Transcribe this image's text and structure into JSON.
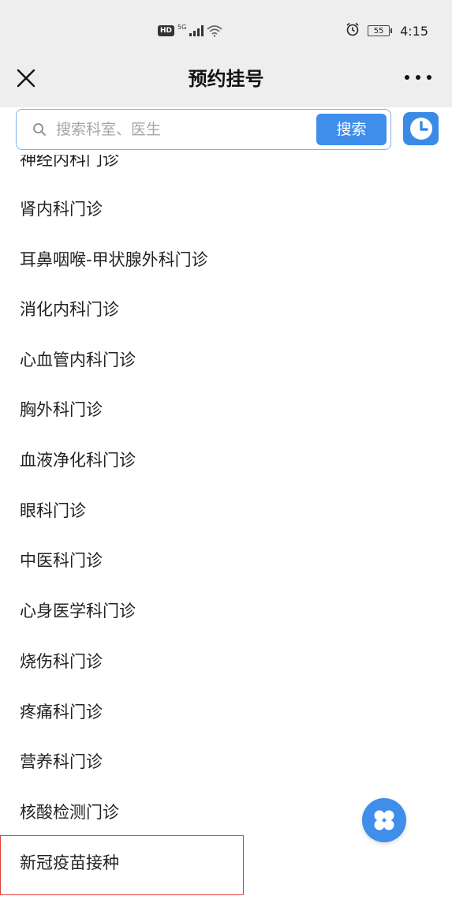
{
  "status_bar": {
    "hd": "HD",
    "network": "5G",
    "battery": "55",
    "time": "4:15"
  },
  "header": {
    "title": "预约挂号"
  },
  "search": {
    "placeholder": "搜索科室、医生",
    "button_label": "搜索"
  },
  "departments": [
    "神经内科门诊",
    "肾内科门诊",
    "耳鼻咽喉-甲状腺外科门诊",
    "消化内科门诊",
    "心血管内科门诊",
    "胸外科门诊",
    "血液净化科门诊",
    "眼科门诊",
    "中医科门诊",
    "心身医学科门诊",
    "烧伤科门诊",
    "疼痛科门诊",
    "营养科门诊",
    "核酸检测门诊",
    "新冠疫苗接种"
  ],
  "colors": {
    "accent": "#3f8ee9",
    "highlight": "#e0403a",
    "header_bg": "#eeeeee"
  },
  "icons": {
    "close": "close-icon",
    "more": "more-icon",
    "search": "search-icon",
    "history": "clock-icon",
    "float": "grid-icon"
  }
}
